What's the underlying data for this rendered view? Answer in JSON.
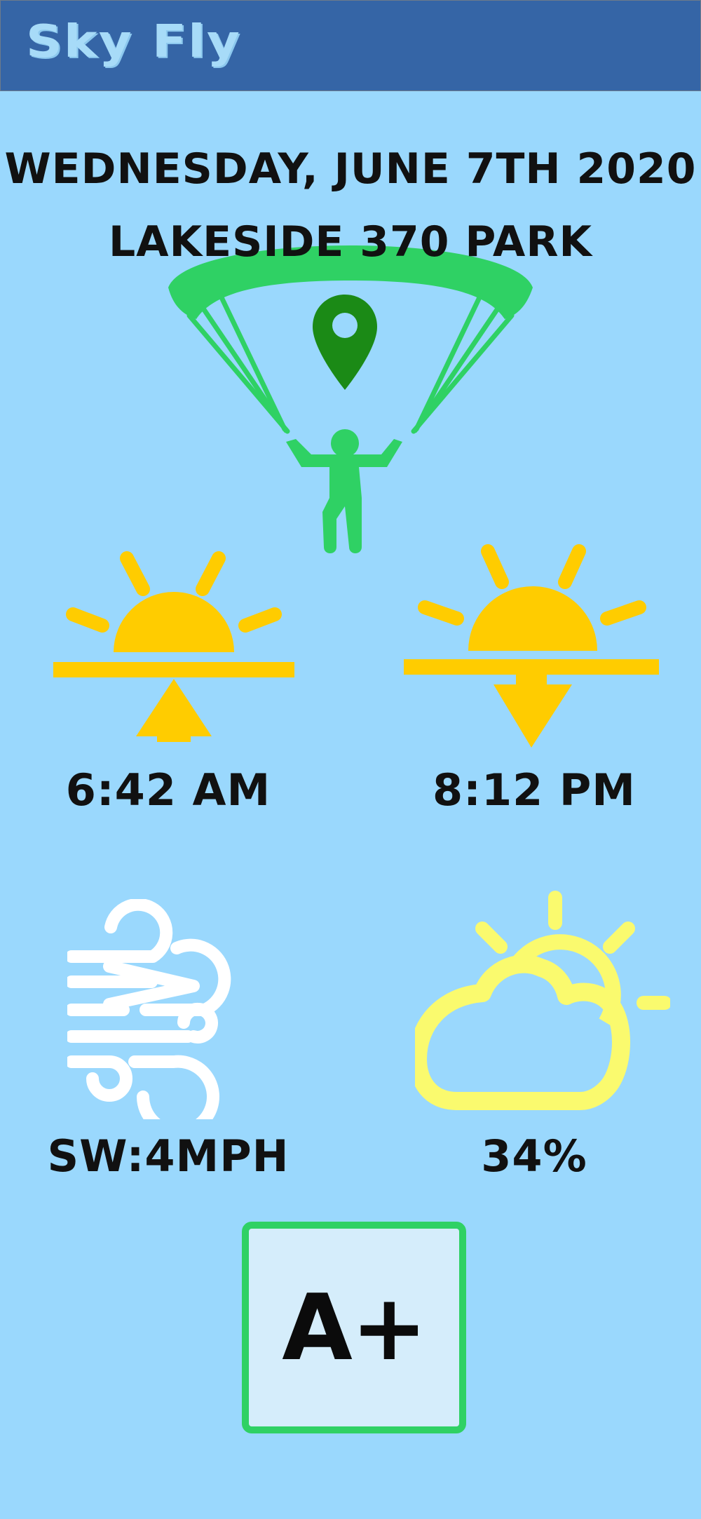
{
  "app": {
    "name": "Sky Fly"
  },
  "header": {
    "date": "WEDNESDAY, JUNE 7TH 2020",
    "location": "LAKESIDE 370 PARK"
  },
  "sun": {
    "sunrise": "6:42 AM",
    "sunset": "8:12 PM"
  },
  "conditions": {
    "wind": "SW:4MPH",
    "cloud_cover": "34%"
  },
  "rating": {
    "grade": "A+"
  },
  "colors": {
    "background": "#9ad8fd",
    "header_bar": "#3565a6",
    "sun_yellow": "#ffcc00",
    "parachute_green": "#2fd164",
    "pin_green": "#1b8a16",
    "cloud_yellow": "#fafa6e",
    "wind_white": "#ffffff"
  },
  "icons": {
    "hero": "paraglider-icon",
    "pin": "location-pin-icon",
    "sunrise": "sunrise-icon",
    "sunset": "sunset-icon",
    "wind": "wind-icon",
    "cloud": "partly-cloudy-icon"
  }
}
